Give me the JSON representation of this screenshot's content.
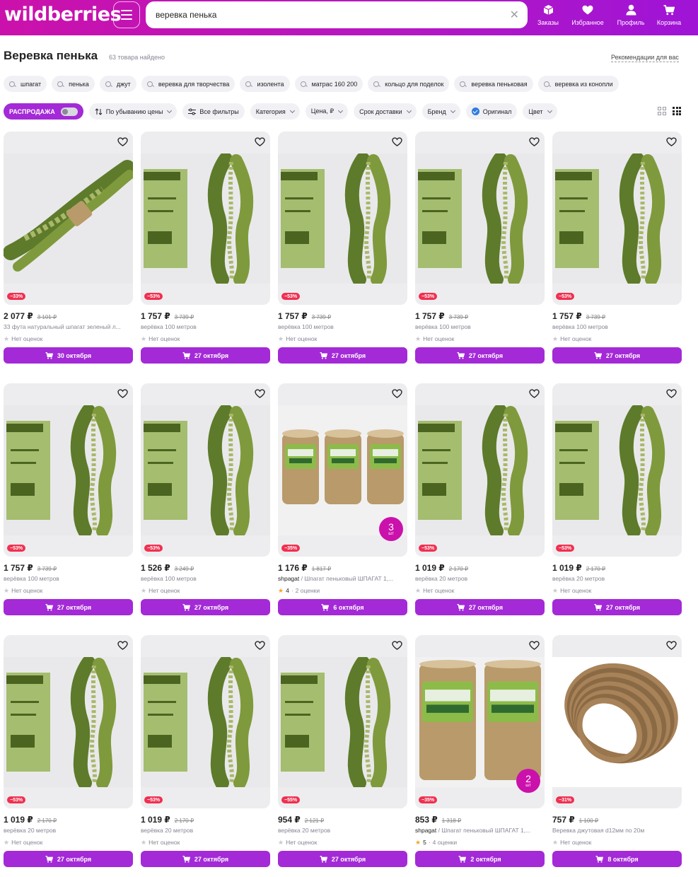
{
  "header": {
    "logo": "wildberries",
    "search_value": "веревка пенька",
    "nav": [
      {
        "label": "Заказы",
        "icon": "box-icon"
      },
      {
        "label": "Избранное",
        "icon": "heart-icon"
      },
      {
        "label": "Профиль",
        "icon": "user-icon"
      },
      {
        "label": "Корзина",
        "icon": "cart-icon"
      }
    ]
  },
  "page": {
    "title": "Веревка пенька",
    "count": "63 товара найдено",
    "recommendations": "Рекомендации для вас"
  },
  "chips": [
    "шпагат",
    "пенька",
    "джут",
    "веревка для творчества",
    "изолента",
    "матрас 160 200",
    "кольцо для поделок",
    "веревка пеньковая",
    "веревка из конопли"
  ],
  "filters": {
    "sale": "РАСПРОДАЖА",
    "sort": "По убыванию цены",
    "all": "Все фильтры",
    "category": "Категория",
    "price": "Цена, ₽",
    "delivery": "Срок доставки",
    "brand": "Бренд",
    "original": "Оригинал",
    "color": "Цвет"
  },
  "colors": {
    "accent": "#a32ad6",
    "brand": "#cb11ab",
    "discount": "#f03050"
  },
  "products": [
    {
      "price": "2 077 ₽",
      "old_price": "3 101 ₽",
      "discount": "−33%",
      "brand": "",
      "name": "33 фута натуральный шпагат зеленый л...",
      "rating": "Нет оценок",
      "rating_value": "",
      "delivery": "30 октября",
      "image": "leaf-twine-bundle",
      "qty": ""
    },
    {
      "price": "1 757 ₽",
      "old_price": "3 739 ₽",
      "discount": "−53%",
      "brand": "",
      "name": "верёвка 100 метров",
      "rating": "Нет оценок",
      "rating_value": "",
      "delivery": "27 октября",
      "image": "packaged-cord-card",
      "qty": ""
    },
    {
      "price": "1 757 ₽",
      "old_price": "3 739 ₽",
      "discount": "−53%",
      "brand": "",
      "name": "верёвка 100 метров",
      "rating": "Нет оценок",
      "rating_value": "",
      "delivery": "27 октября",
      "image": "packaged-cord-card",
      "qty": ""
    },
    {
      "price": "1 757 ₽",
      "old_price": "3 739 ₽",
      "discount": "−53%",
      "brand": "",
      "name": "верёвка 100 метров",
      "rating": "Нет оценок",
      "rating_value": "",
      "delivery": "27 октября",
      "image": "packaged-cord-card",
      "qty": ""
    },
    {
      "price": "1 757 ₽",
      "old_price": "3 739 ₽",
      "discount": "−53%",
      "brand": "",
      "name": "верёвка 100 метров",
      "rating": "Нет оценок",
      "rating_value": "",
      "delivery": "27 октября",
      "image": "packaged-cord-card",
      "qty": ""
    },
    {
      "price": "1 757 ₽",
      "old_price": "3 739 ₽",
      "discount": "−53%",
      "brand": "",
      "name": "верёвка 100 метров",
      "rating": "Нет оценок",
      "rating_value": "",
      "delivery": "27 октября",
      "image": "packaged-cord-card",
      "qty": ""
    },
    {
      "price": "1 526 ₽",
      "old_price": "3 249 ₽",
      "discount": "−53%",
      "brand": "",
      "name": "верёвка 100 метров",
      "rating": "Нет оценок",
      "rating_value": "",
      "delivery": "27 октября",
      "image": "packaged-cord-card",
      "qty": ""
    },
    {
      "price": "1 176 ₽",
      "old_price": "1 817 ₽",
      "discount": "−35%",
      "brand": "shpagat",
      "name": " / Шпагат пеньковый ШПАГАТ 1,...",
      "rating": "2 оценки",
      "rating_value": "4",
      "delivery": "6 октября",
      "image": "twine-spools-three",
      "qty": "3"
    },
    {
      "price": "1 019 ₽",
      "old_price": "2 170 ₽",
      "discount": "−53%",
      "brand": "",
      "name": "верёвка 20 метров",
      "rating": "Нет оценок",
      "rating_value": "",
      "delivery": "27 октября",
      "image": "packaged-cord-card",
      "qty": ""
    },
    {
      "price": "1 019 ₽",
      "old_price": "2 170 ₽",
      "discount": "−53%",
      "brand": "",
      "name": "верёвка 20 метров",
      "rating": "Нет оценок",
      "rating_value": "",
      "delivery": "27 октября",
      "image": "packaged-cord-card",
      "qty": ""
    },
    {
      "price": "1 019 ₽",
      "old_price": "2 170 ₽",
      "discount": "−53%",
      "brand": "",
      "name": "верёвка 20 метров",
      "rating": "Нет оценок",
      "rating_value": "",
      "delivery": "27 октября",
      "image": "packaged-cord-card",
      "qty": ""
    },
    {
      "price": "1 019 ₽",
      "old_price": "2 170 ₽",
      "discount": "−53%",
      "brand": "",
      "name": "верёвка 20 метров",
      "rating": "Нет оценок",
      "rating_value": "",
      "delivery": "27 октября",
      "image": "packaged-cord-card",
      "qty": ""
    },
    {
      "price": "954 ₽",
      "old_price": "2 121 ₽",
      "discount": "−55%",
      "brand": "",
      "name": "верёвка 20 метров",
      "rating": "Нет оценок",
      "rating_value": "",
      "delivery": "27 октября",
      "image": "packaged-cord-card",
      "qty": ""
    },
    {
      "price": "853 ₽",
      "old_price": "1 318 ₽",
      "discount": "−35%",
      "brand": "shpagat",
      "name": " / Шпагат пеньковый ШПАГАТ 1,...",
      "rating": "4 оценки",
      "rating_value": "5",
      "delivery": "2 октября",
      "image": "twine-spools-two",
      "qty": "2"
    },
    {
      "price": "757 ₽",
      "old_price": "1 100 ₽",
      "discount": "−31%",
      "brand": "",
      "name": "Веревка джутовая d12мм по 20м",
      "rating": "Нет оценок",
      "rating_value": "",
      "delivery": "8 октября",
      "image": "jute-rope-coil",
      "qty": ""
    }
  ],
  "labels": {
    "qty_unit": "шт"
  }
}
